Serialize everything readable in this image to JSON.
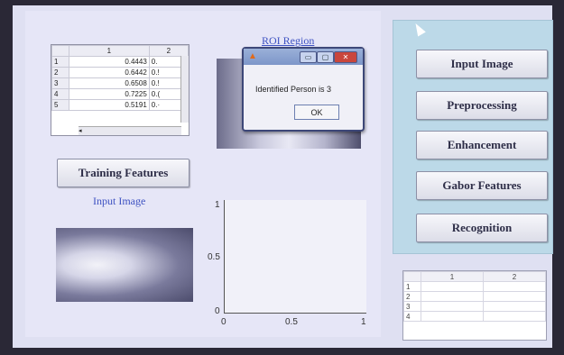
{
  "table1": {
    "headers": [
      "1",
      "2"
    ],
    "rows": [
      {
        "index": "1",
        "col1": "0.4443",
        "col2": "0."
      },
      {
        "index": "2",
        "col1": "0.6442",
        "col2": "0.!"
      },
      {
        "index": "3",
        "col1": "0.6508",
        "col2": "0.!"
      },
      {
        "index": "4",
        "col1": "0.7225",
        "col2": "0.("
      },
      {
        "index": "5",
        "col1": "0.5191",
        "col2": "0.·"
      }
    ]
  },
  "roi_label": "ROI Region",
  "training_button": "Training Features",
  "input_image_label": "Input Image",
  "dialog": {
    "message": "Identified Person is 3",
    "ok": "OK",
    "minimize": "▭",
    "maximize": "▢",
    "close": "✕"
  },
  "plot": {
    "y_ticks": [
      "1",
      "0.5",
      "0"
    ],
    "x_ticks": [
      "0",
      "0.5",
      "1"
    ]
  },
  "right_buttons": {
    "input_image": "Input Image",
    "preprocessing": "Preprocessing",
    "enhancement": "Enhancement",
    "gabor": "Gabor Features",
    "recognition": "Recognition"
  },
  "table2": {
    "headers": [
      "1",
      "2"
    ],
    "rows": [
      "1",
      "2",
      "3",
      "4"
    ]
  },
  "colors": {
    "accent_blue": "#3e52c2",
    "panel_teal": "#bcd9e8"
  }
}
